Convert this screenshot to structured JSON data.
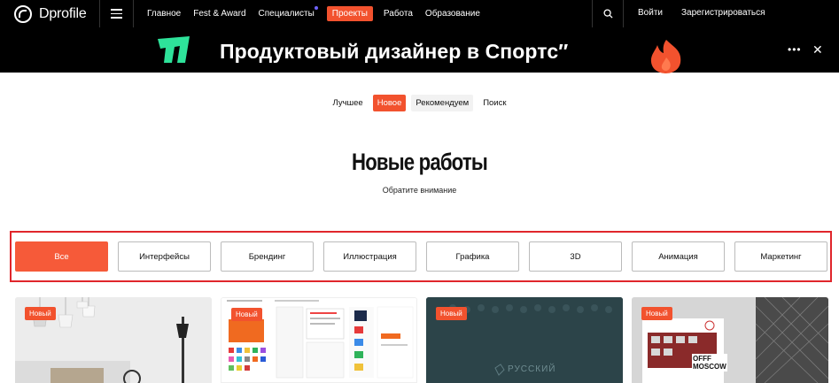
{
  "header": {
    "logo_text": "Dprofile",
    "nav": [
      {
        "label": "Главное",
        "active": false
      },
      {
        "label": "Fest & Award",
        "active": false
      },
      {
        "label": "Специалисты",
        "active": false,
        "notification_dot": true
      },
      {
        "label": "Проекты",
        "active": true
      },
      {
        "label": "Работа",
        "active": false
      },
      {
        "label": "Образование",
        "active": false
      }
    ],
    "login": "Войти",
    "register": "Зарегистрироваться"
  },
  "banner": {
    "text": "Продуктовый дизайнер в Спортс″"
  },
  "tabs": [
    {
      "label": "Лучшее",
      "state": "plain"
    },
    {
      "label": "Новое",
      "state": "active"
    },
    {
      "label": "Рекомендуем",
      "state": "muted"
    },
    {
      "label": "Поиск",
      "state": "plain"
    }
  ],
  "page": {
    "title": "Новые работы",
    "subtitle": "Обратите внимание"
  },
  "categories": [
    {
      "label": "Все",
      "active": true
    },
    {
      "label": "Интерфейсы",
      "active": false
    },
    {
      "label": "Брендинг",
      "active": false
    },
    {
      "label": "Иллюстрация",
      "active": false
    },
    {
      "label": "Графика",
      "active": false
    },
    {
      "label": "3D",
      "active": false
    },
    {
      "label": "Анимация",
      "active": false
    },
    {
      "label": "Маркетинг",
      "active": false
    }
  ],
  "cards": [
    {
      "badge": "Новый"
    },
    {
      "badge": "Новый"
    },
    {
      "badge": "Новый",
      "watermark": "РУССКИЙ"
    },
    {
      "badge": "Новый",
      "poster_text": "OFFF MOSCOW"
    }
  ],
  "colors": {
    "accent": "#f2522e",
    "highlight_frame": "#e0262b",
    "nav_bg": "#000000",
    "banner_logo": "#2ee29a"
  }
}
